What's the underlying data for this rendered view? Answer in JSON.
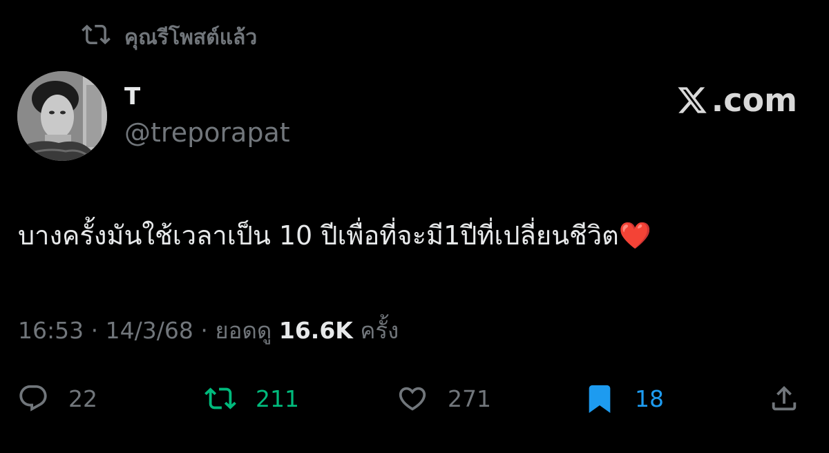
{
  "repost_banner": {
    "icon": "repost-icon",
    "text": "คุณรีโพสต์แล้ว"
  },
  "author": {
    "display_name": "T",
    "handle": "@treporapat",
    "avatar": "avatar-photo"
  },
  "brand": {
    "icon": "x-logo-icon",
    "text": ".com"
  },
  "tweet": {
    "text": "บางครั้งมันใช้เวลาเป็น 10 ปีเพื่อที่จะมี1ปีที่เปลี่ยนชีวิต",
    "emoji": "❤️"
  },
  "meta": {
    "time": "16:53",
    "separator": "·",
    "date": "14/3/68",
    "views_label": "ยอดดู",
    "views_count": "16.6K",
    "views_unit": "ครั้ง"
  },
  "actions": {
    "reply": {
      "icon": "reply-icon",
      "count": "22"
    },
    "repost": {
      "icon": "repost-icon",
      "count": "211",
      "active": true,
      "color": "#00ba7c"
    },
    "like": {
      "icon": "heart-icon",
      "count": "271"
    },
    "bookmark": {
      "icon": "bookmark-icon",
      "count": "18",
      "active": true,
      "color": "#1d9bf0"
    },
    "share": {
      "icon": "share-icon"
    }
  },
  "colors": {
    "background": "#000000",
    "text_primary": "#e7e9ea",
    "text_secondary": "#71767b",
    "repost_active": "#00ba7c",
    "bookmark_active": "#1d9bf0",
    "heart_emoji": "#e0245e"
  }
}
